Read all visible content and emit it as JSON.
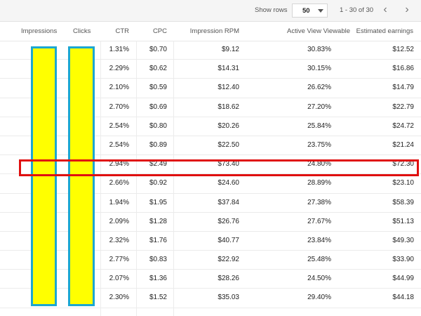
{
  "toolbar": {
    "show_rows_label": "Show rows",
    "rows_per_page": "50",
    "range_label": "1 - 30 of 30",
    "prev_icon": "chevron-left-icon",
    "next_icon": "chevron-right-icon"
  },
  "table": {
    "headers": {
      "impressions": "Impressions",
      "clicks": "Clicks",
      "ctr": "CTR",
      "cpc": "CPC",
      "rpm": "Impression RPM",
      "viewable": "Active View Viewable",
      "earnings": "Estimated earnings"
    },
    "rows": [
      {
        "ctr": "1.31%",
        "cpc": "$0.70",
        "rpm": "$9.12",
        "viewable": "30.83%",
        "earnings": "$12.52"
      },
      {
        "ctr": "2.29%",
        "cpc": "$0.62",
        "rpm": "$14.31",
        "viewable": "30.15%",
        "earnings": "$16.86"
      },
      {
        "ctr": "2.10%",
        "cpc": "$0.59",
        "rpm": "$12.40",
        "viewable": "26.62%",
        "earnings": "$14.79"
      },
      {
        "ctr": "2.70%",
        "cpc": "$0.69",
        "rpm": "$18.62",
        "viewable": "27.20%",
        "earnings": "$22.79"
      },
      {
        "ctr": "2.54%",
        "cpc": "$0.80",
        "rpm": "$20.26",
        "viewable": "25.84%",
        "earnings": "$24.72"
      },
      {
        "ctr": "2.54%",
        "cpc": "$0.89",
        "rpm": "$22.50",
        "viewable": "23.75%",
        "earnings": "$21.24"
      },
      {
        "ctr": "2.94%",
        "cpc": "$2.49",
        "rpm": "$73.40",
        "viewable": "24.80%",
        "earnings": "$72.30"
      },
      {
        "ctr": "2.66%",
        "cpc": "$0.92",
        "rpm": "$24.60",
        "viewable": "28.89%",
        "earnings": "$23.10"
      },
      {
        "ctr": "1.94%",
        "cpc": "$1.95",
        "rpm": "$37.84",
        "viewable": "27.38%",
        "earnings": "$58.39"
      },
      {
        "ctr": "2.09%",
        "cpc": "$1.28",
        "rpm": "$26.76",
        "viewable": "27.67%",
        "earnings": "$51.13"
      },
      {
        "ctr": "2.32%",
        "cpc": "$1.76",
        "rpm": "$40.77",
        "viewable": "23.84%",
        "earnings": "$49.30"
      },
      {
        "ctr": "2.77%",
        "cpc": "$0.83",
        "rpm": "$22.92",
        "viewable": "25.48%",
        "earnings": "$33.90"
      },
      {
        "ctr": "2.07%",
        "cpc": "$1.36",
        "rpm": "$28.26",
        "viewable": "24.50%",
        "earnings": "$44.99"
      },
      {
        "ctr": "2.30%",
        "cpc": "$1.52",
        "rpm": "$35.03",
        "viewable": "29.40%",
        "earnings": "$44.18"
      }
    ]
  },
  "annotations": {
    "highlight_fill": "#ffff00",
    "highlight_border": "#1ca7d1",
    "row_box_color": "#e01010"
  }
}
